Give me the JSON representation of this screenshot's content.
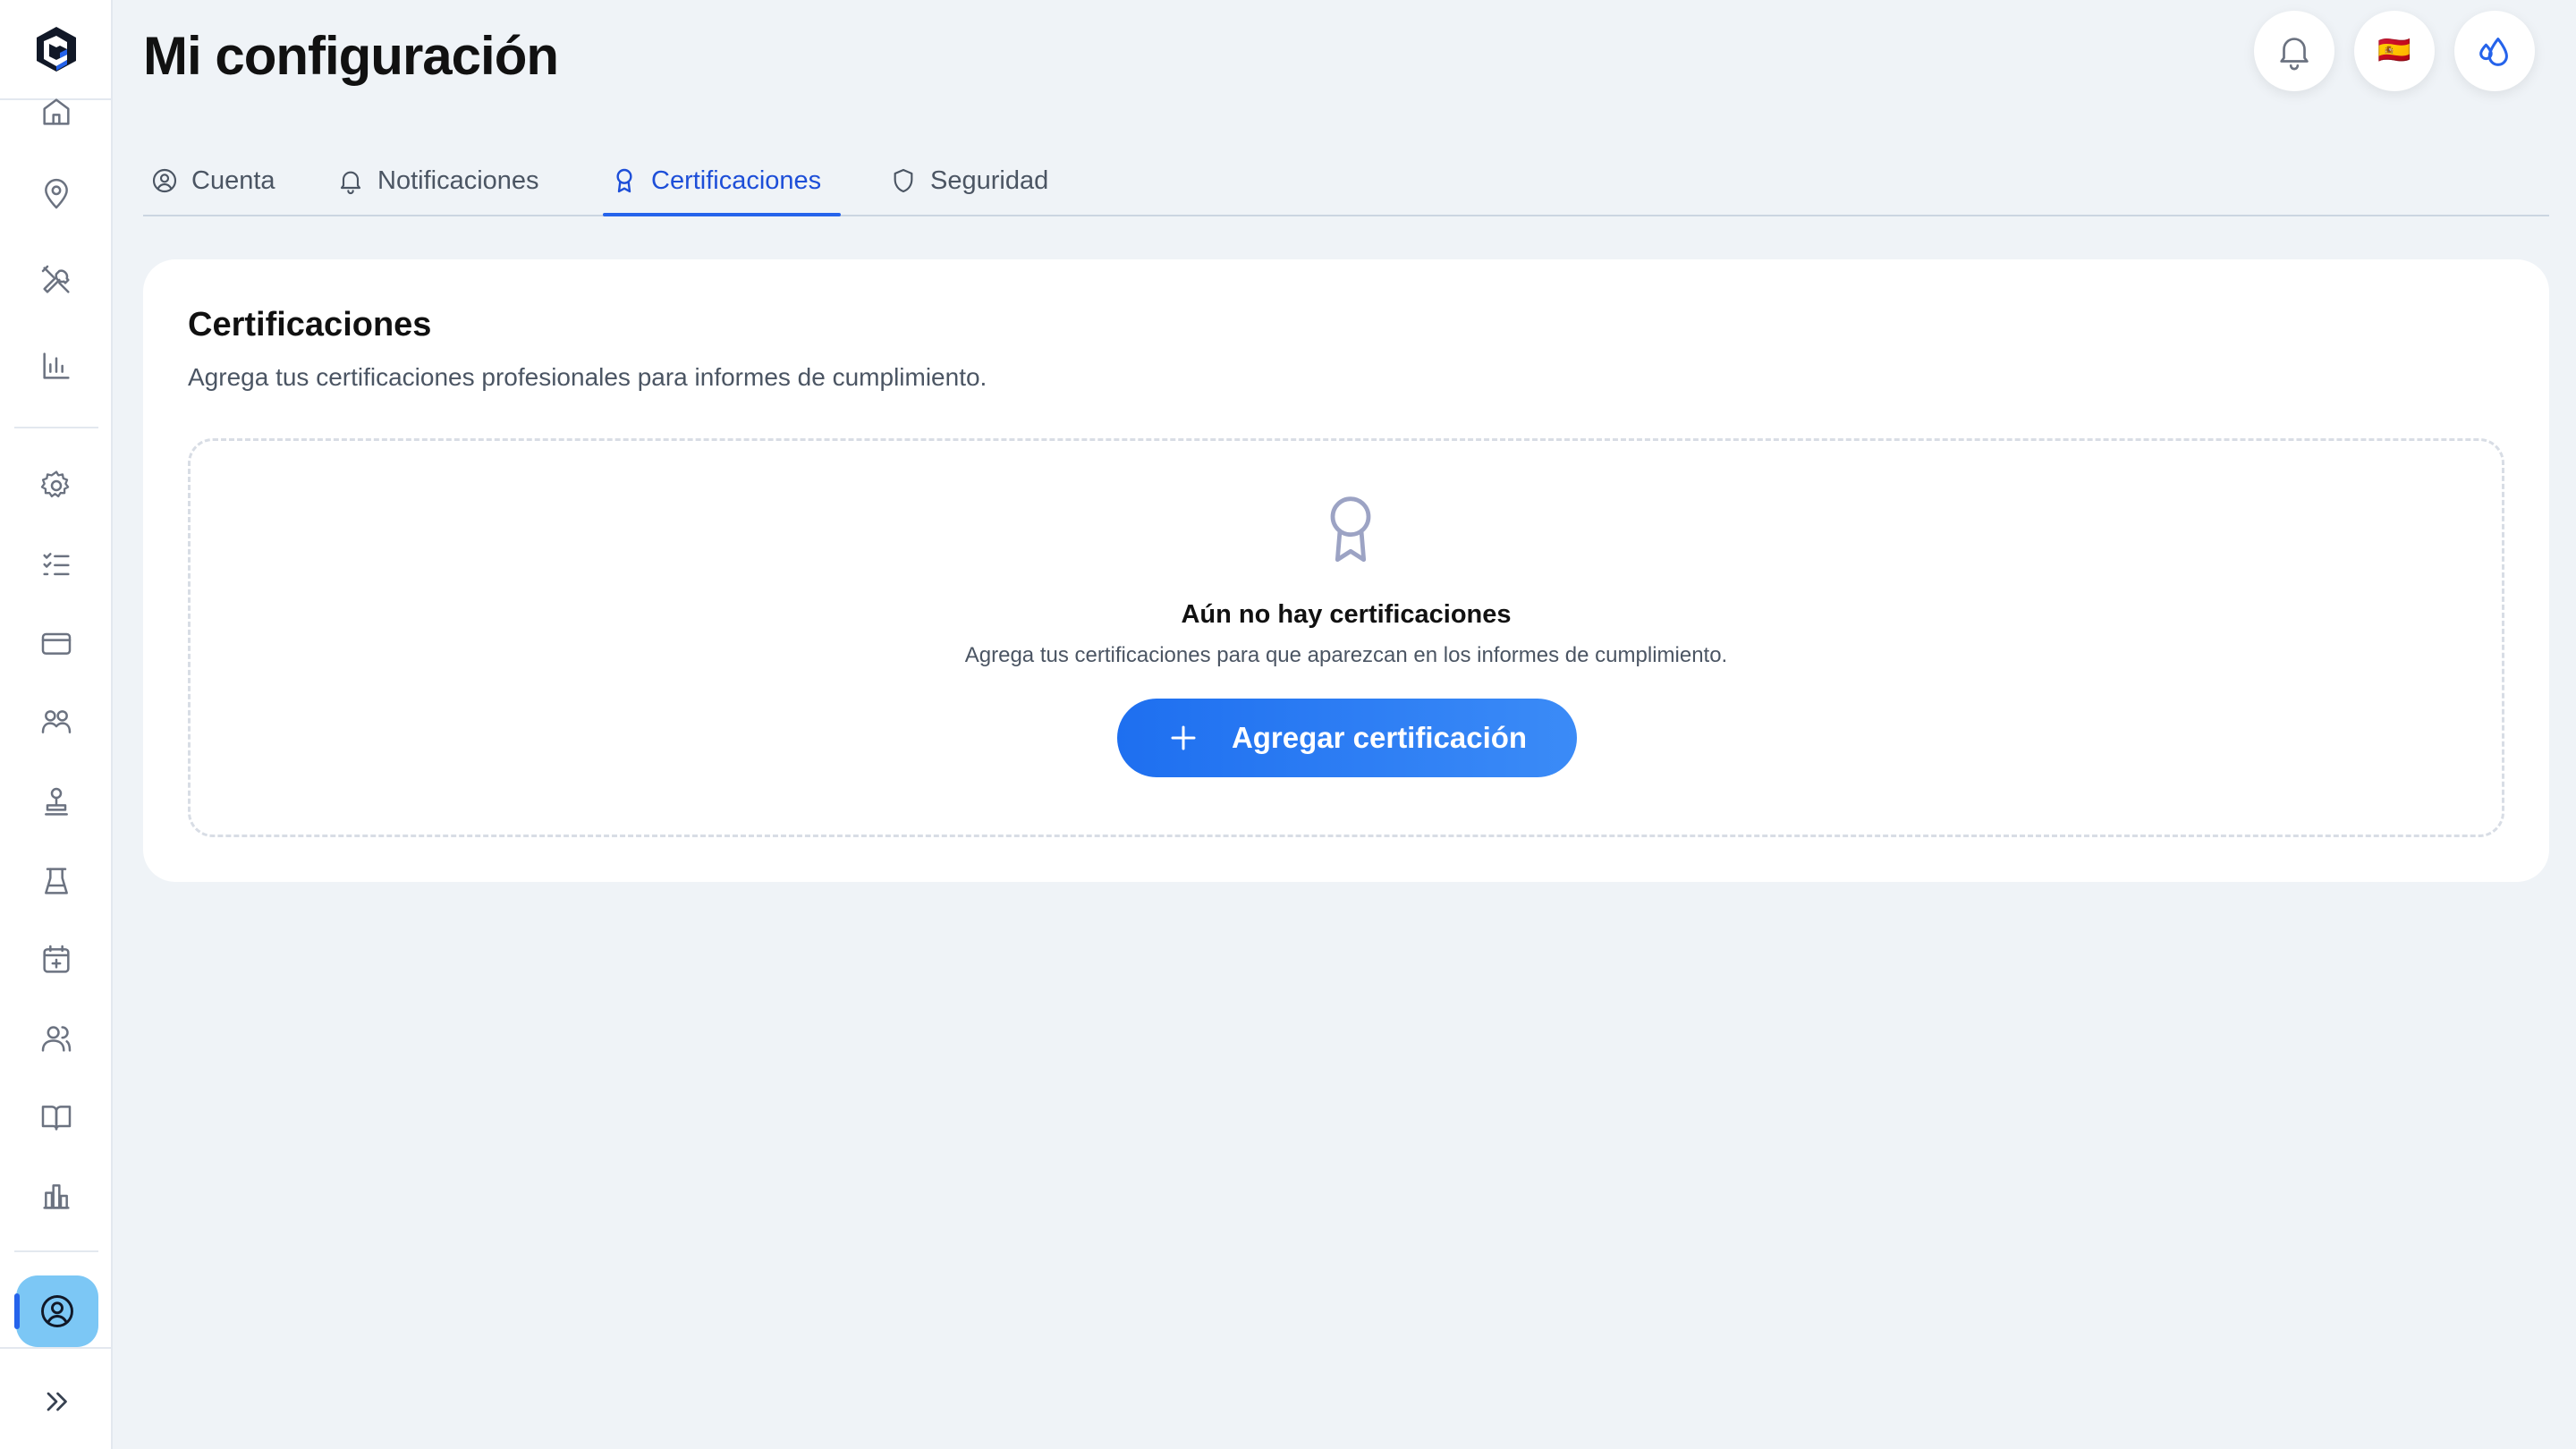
{
  "app": {
    "page_title": "Mi configuración"
  },
  "header": {
    "language_flag": "🇪🇸"
  },
  "tabs": [
    {
      "label": "Cuenta",
      "icon": "user-circle-icon"
    },
    {
      "label": "Notificaciones",
      "icon": "bell-icon"
    },
    {
      "label": "Certificaciones",
      "icon": "award-icon",
      "active": true
    },
    {
      "label": "Seguridad",
      "icon": "shield-icon"
    }
  ],
  "sidebar": {
    "items": [
      {
        "icon": "home-icon"
      },
      {
        "icon": "map-pin-icon"
      },
      {
        "icon": "tools-icon"
      },
      {
        "icon": "bar-chart-icon"
      },
      {
        "icon": "gear-icon"
      },
      {
        "icon": "checklist-icon"
      },
      {
        "icon": "credit-card-icon"
      },
      {
        "icon": "groups-icon"
      },
      {
        "icon": "stamp-icon"
      },
      {
        "icon": "flask-icon"
      },
      {
        "icon": "calendar-plus-icon"
      },
      {
        "icon": "users-icon"
      },
      {
        "icon": "book-open-icon"
      },
      {
        "icon": "building-chart-icon"
      }
    ],
    "active_item": {
      "icon": "user-circle-icon"
    },
    "expand": {
      "icon": "chevrons-right-icon"
    }
  },
  "card": {
    "title": "Certificaciones",
    "description": "Agrega tus certificaciones profesionales para informes de cumplimiento.",
    "empty_state": {
      "title": "Aún no hay certificaciones",
      "description": "Agrega tus certificaciones para que aparezcan en los informes de cumplimiento.",
      "button_label": "Agregar certificación"
    }
  },
  "colors": {
    "accent": "#2563eb",
    "background": "#eff3f7",
    "active_sidebar": "#7cc7f5",
    "icon": "#6b7280"
  }
}
